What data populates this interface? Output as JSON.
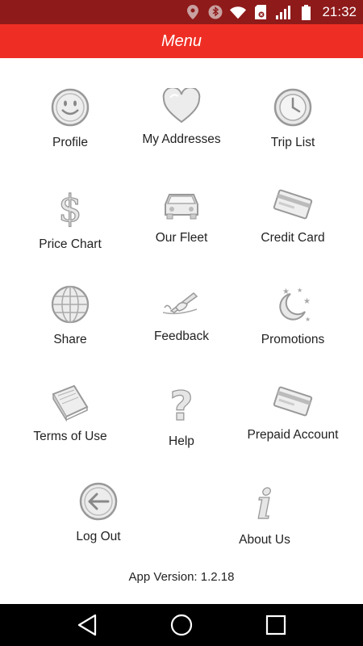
{
  "status_bar": {
    "time": "21:32",
    "icons": [
      "location-icon",
      "bluetooth-icon",
      "wifi-icon",
      "sim-icon",
      "signal-icon",
      "battery-icon"
    ],
    "background": "#8e1a1a"
  },
  "app_bar": {
    "title": "Menu",
    "background": "#ee2e24"
  },
  "menu": {
    "items": [
      {
        "label": "Profile",
        "icon": "smiley-icon"
      },
      {
        "label": "My Addresses",
        "icon": "heart-icon"
      },
      {
        "label": "Trip List",
        "icon": "clock-icon"
      },
      {
        "label": "Price Chart",
        "icon": "dollar-icon"
      },
      {
        "label": "Our Fleet",
        "icon": "car-icon"
      },
      {
        "label": "Credit Card",
        "icon": "credit-card-icon"
      },
      {
        "label": "Share",
        "icon": "globe-icon"
      },
      {
        "label": "Feedback",
        "icon": "writing-hand-icon"
      },
      {
        "label": "Promotions",
        "icon": "moon-stars-icon"
      },
      {
        "label": "Terms of Use",
        "icon": "book-icon"
      },
      {
        "label": "Help",
        "icon": "question-icon"
      },
      {
        "label": "Prepaid Account",
        "icon": "prepaid-card-icon"
      },
      {
        "label": "Log Out",
        "icon": "arrow-left-circle-icon"
      },
      {
        "label": "About Us",
        "icon": "info-icon"
      }
    ]
  },
  "footer": {
    "version": "App Version: 1.2.18"
  },
  "nav_bar": {
    "buttons": [
      "back-icon",
      "home-icon",
      "recents-icon"
    ]
  }
}
